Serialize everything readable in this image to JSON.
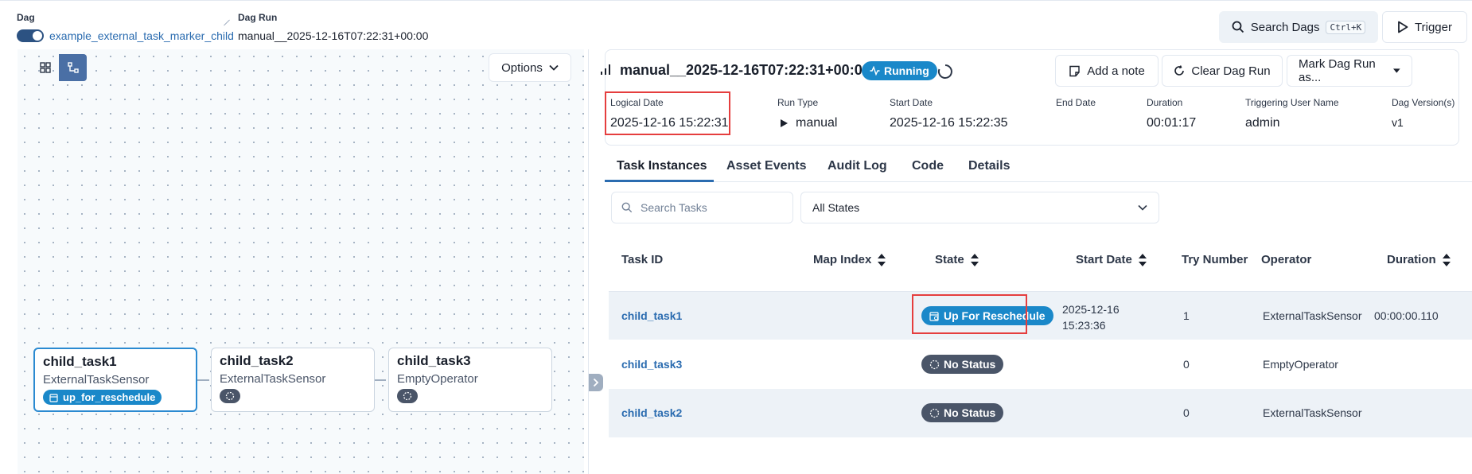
{
  "breadcrumb": {
    "dag_label": "Dag",
    "dag_id": "example_external_task_marker_child",
    "dagrun_label": "Dag Run",
    "dagrun_id": "manual__2025-12-16T07:22:31+00:00"
  },
  "header": {
    "search_label": "Search Dags",
    "search_shortcut": "Ctrl+K",
    "trigger_label": "Trigger"
  },
  "graph": {
    "options_label": "Options",
    "nodes": [
      {
        "name": "child_task1",
        "operator": "ExternalTaskSensor",
        "state": "up_for_reschedule"
      },
      {
        "name": "child_task2",
        "operator": "ExternalTaskSensor",
        "state": ""
      },
      {
        "name": "child_task3",
        "operator": "EmptyOperator",
        "state": ""
      }
    ]
  },
  "run": {
    "title": "manual__2025-12-16T07:22:31+00:00",
    "status": "Running",
    "actions": {
      "note": "Add a note",
      "clear": "Clear Dag Run",
      "mark": "Mark Dag Run as..."
    },
    "meta": [
      {
        "label": "Logical Date",
        "value": "2025-12-16 15:22:31"
      },
      {
        "label": "Run Type",
        "value": "manual"
      },
      {
        "label": "Start Date",
        "value": "2025-12-16 15:22:35"
      },
      {
        "label": "End Date",
        "value": ""
      },
      {
        "label": "Duration",
        "value": "00:01:17"
      },
      {
        "label": "Triggering User Name",
        "value": "admin"
      },
      {
        "label": "Dag Version(s)",
        "value": "v1"
      }
    ]
  },
  "tabs": [
    "Task Instances",
    "Asset Events",
    "Audit Log",
    "Code",
    "Details"
  ],
  "filters": {
    "search_placeholder": "Search Tasks",
    "state_select": "All States"
  },
  "table": {
    "columns": [
      "Task ID",
      "Map Index",
      "State",
      "Start Date",
      "Try Number",
      "Operator",
      "Duration"
    ],
    "rows": [
      {
        "task_id": "child_task1",
        "map_index": "",
        "state": "Up For Reschedule",
        "start_date_1": "2025-12-16",
        "start_date_2": "15:23:36",
        "try_number": "1",
        "operator": "ExternalTaskSensor",
        "duration": "00:00:00.110"
      },
      {
        "task_id": "child_task3",
        "map_index": "",
        "state": "No Status",
        "start_date_1": "",
        "start_date_2": "",
        "try_number": "0",
        "operator": "EmptyOperator",
        "duration": ""
      },
      {
        "task_id": "child_task2",
        "map_index": "",
        "state": "No Status",
        "start_date_1": "",
        "start_date_2": "",
        "try_number": "0",
        "operator": "ExternalTaskSensor",
        "duration": ""
      }
    ]
  },
  "colors": {
    "accent": "#2b6cb0",
    "running": "#1a88c9",
    "no_status": "#4a5568",
    "highlight": "#e53e3e"
  }
}
